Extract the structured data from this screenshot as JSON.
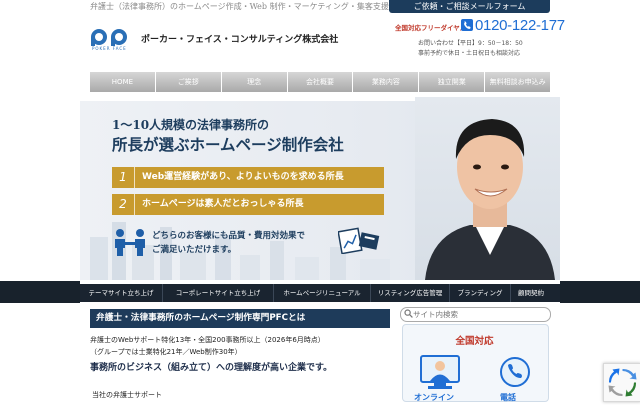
{
  "header": {
    "tagline": "弁護士（法律事務所）のホームページ作成・Web 制作・マーケティング・集客支援",
    "logo_text": "PP",
    "logo_sub": "POKER FACE",
    "company_name": "ポーカー・フェイス・コンサルティング株式会社",
    "mail_button": "ご依頼・ご相談メールフォーム",
    "free_dial_label": "全国対応フリーダイヤル",
    "phone": "0120-122-177",
    "hours": "お問い合わせ【平日】9：50－18：50",
    "note": "事前予約で休日・土日祝日も相談対応"
  },
  "global_nav": [
    "HOME",
    "ご挨拶",
    "理念",
    "会社概要",
    "業務内容",
    "独立開業",
    "無料相談お申込み"
  ],
  "hero": {
    "headline_1": "1～10人規模の法律事務所の",
    "headline_2": "所長が選ぶホームページ制作会社",
    "points": [
      {
        "num": "1",
        "text": "Web運営経験があり、よりよいものを求める所長"
      },
      {
        "num": "2",
        "text": "ホームページは素人だとおっしゃる所長"
      }
    ],
    "sub_1": "どちらのお客様にも品質・費用対効果で",
    "sub_2": "ご満足いただけます。"
  },
  "sub_nav": [
    "テーマサイト立ち上げ",
    "コーポレートサイト立ち上げ",
    "ホームページリニューアル",
    "リスティング広告管理",
    "ブランディング",
    "顧問契約"
  ],
  "content": {
    "section_title": "弁護士・法律事務所のホームページ制作専門PFCとは",
    "line_1": "弁護士のWebサポート特化13年・全国200事務所以上（2026年6月時点）",
    "line_2": "（グループでは士業特化21年／Web制作30年）",
    "line_3": "事務所のビジネス（組み立て）への理解度が高い企業です。",
    "sub_head": "当社の弁護士サポート"
  },
  "sidebar": {
    "search_placeholder": "サイト内検索",
    "box_title": "全国対応",
    "label_1": "オンライン",
    "label_2": "電話"
  },
  "colors": {
    "navy": "#1e3b5a",
    "gold": "#c89b2e",
    "phone_blue": "#1f6ed4",
    "accent_red": "#c0392b"
  }
}
